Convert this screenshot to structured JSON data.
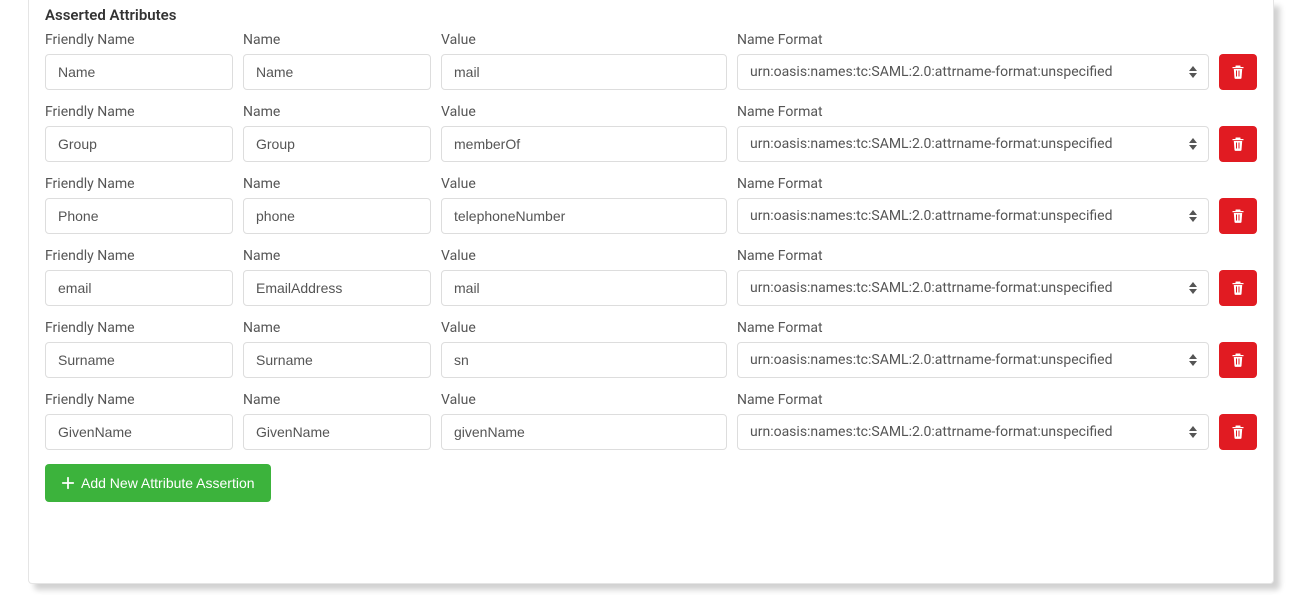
{
  "section_title": "Asserted Attributes",
  "labels": {
    "friendly_name": "Friendly Name",
    "name": "Name",
    "value": "Value",
    "name_format": "Name Format"
  },
  "rows": [
    {
      "friendly": "Name",
      "name": "Name",
      "value": "mail",
      "format": "urn:oasis:names:tc:SAML:2.0:attrname-format:unspecified"
    },
    {
      "friendly": "Group",
      "name": "Group",
      "value": "memberOf",
      "format": "urn:oasis:names:tc:SAML:2.0:attrname-format:unspecified"
    },
    {
      "friendly": "Phone",
      "name": "phone",
      "value": "telephoneNumber",
      "format": "urn:oasis:names:tc:SAML:2.0:attrname-format:unspecified"
    },
    {
      "friendly": "email",
      "name": "EmailAddress",
      "value": "mail",
      "format": "urn:oasis:names:tc:SAML:2.0:attrname-format:unspecified"
    },
    {
      "friendly": "Surname",
      "name": "Surname",
      "value": "sn",
      "format": "urn:oasis:names:tc:SAML:2.0:attrname-format:unspecified"
    },
    {
      "friendly": "GivenName",
      "name": "GivenName",
      "value": "givenName",
      "format": "urn:oasis:names:tc:SAML:2.0:attrname-format:unspecified"
    }
  ],
  "add_button_label": "Add New Attribute Assertion"
}
